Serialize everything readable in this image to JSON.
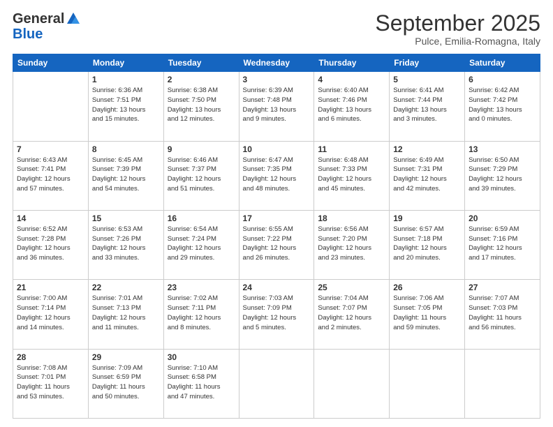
{
  "header": {
    "logo_general": "General",
    "logo_blue": "Blue",
    "month_title": "September 2025",
    "subtitle": "Pulce, Emilia-Romagna, Italy"
  },
  "columns": [
    "Sunday",
    "Monday",
    "Tuesday",
    "Wednesday",
    "Thursday",
    "Friday",
    "Saturday"
  ],
  "weeks": [
    [
      {
        "num": "",
        "info": ""
      },
      {
        "num": "1",
        "info": "Sunrise: 6:36 AM\nSunset: 7:51 PM\nDaylight: 13 hours\nand 15 minutes."
      },
      {
        "num": "2",
        "info": "Sunrise: 6:38 AM\nSunset: 7:50 PM\nDaylight: 13 hours\nand 12 minutes."
      },
      {
        "num": "3",
        "info": "Sunrise: 6:39 AM\nSunset: 7:48 PM\nDaylight: 13 hours\nand 9 minutes."
      },
      {
        "num": "4",
        "info": "Sunrise: 6:40 AM\nSunset: 7:46 PM\nDaylight: 13 hours\nand 6 minutes."
      },
      {
        "num": "5",
        "info": "Sunrise: 6:41 AM\nSunset: 7:44 PM\nDaylight: 13 hours\nand 3 minutes."
      },
      {
        "num": "6",
        "info": "Sunrise: 6:42 AM\nSunset: 7:42 PM\nDaylight: 13 hours\nand 0 minutes."
      }
    ],
    [
      {
        "num": "7",
        "info": "Sunrise: 6:43 AM\nSunset: 7:41 PM\nDaylight: 12 hours\nand 57 minutes."
      },
      {
        "num": "8",
        "info": "Sunrise: 6:45 AM\nSunset: 7:39 PM\nDaylight: 12 hours\nand 54 minutes."
      },
      {
        "num": "9",
        "info": "Sunrise: 6:46 AM\nSunset: 7:37 PM\nDaylight: 12 hours\nand 51 minutes."
      },
      {
        "num": "10",
        "info": "Sunrise: 6:47 AM\nSunset: 7:35 PM\nDaylight: 12 hours\nand 48 minutes."
      },
      {
        "num": "11",
        "info": "Sunrise: 6:48 AM\nSunset: 7:33 PM\nDaylight: 12 hours\nand 45 minutes."
      },
      {
        "num": "12",
        "info": "Sunrise: 6:49 AM\nSunset: 7:31 PM\nDaylight: 12 hours\nand 42 minutes."
      },
      {
        "num": "13",
        "info": "Sunrise: 6:50 AM\nSunset: 7:29 PM\nDaylight: 12 hours\nand 39 minutes."
      }
    ],
    [
      {
        "num": "14",
        "info": "Sunrise: 6:52 AM\nSunset: 7:28 PM\nDaylight: 12 hours\nand 36 minutes."
      },
      {
        "num": "15",
        "info": "Sunrise: 6:53 AM\nSunset: 7:26 PM\nDaylight: 12 hours\nand 33 minutes."
      },
      {
        "num": "16",
        "info": "Sunrise: 6:54 AM\nSunset: 7:24 PM\nDaylight: 12 hours\nand 29 minutes."
      },
      {
        "num": "17",
        "info": "Sunrise: 6:55 AM\nSunset: 7:22 PM\nDaylight: 12 hours\nand 26 minutes."
      },
      {
        "num": "18",
        "info": "Sunrise: 6:56 AM\nSunset: 7:20 PM\nDaylight: 12 hours\nand 23 minutes."
      },
      {
        "num": "19",
        "info": "Sunrise: 6:57 AM\nSunset: 7:18 PM\nDaylight: 12 hours\nand 20 minutes."
      },
      {
        "num": "20",
        "info": "Sunrise: 6:59 AM\nSunset: 7:16 PM\nDaylight: 12 hours\nand 17 minutes."
      }
    ],
    [
      {
        "num": "21",
        "info": "Sunrise: 7:00 AM\nSunset: 7:14 PM\nDaylight: 12 hours\nand 14 minutes."
      },
      {
        "num": "22",
        "info": "Sunrise: 7:01 AM\nSunset: 7:13 PM\nDaylight: 12 hours\nand 11 minutes."
      },
      {
        "num": "23",
        "info": "Sunrise: 7:02 AM\nSunset: 7:11 PM\nDaylight: 12 hours\nand 8 minutes."
      },
      {
        "num": "24",
        "info": "Sunrise: 7:03 AM\nSunset: 7:09 PM\nDaylight: 12 hours\nand 5 minutes."
      },
      {
        "num": "25",
        "info": "Sunrise: 7:04 AM\nSunset: 7:07 PM\nDaylight: 12 hours\nand 2 minutes."
      },
      {
        "num": "26",
        "info": "Sunrise: 7:06 AM\nSunset: 7:05 PM\nDaylight: 11 hours\nand 59 minutes."
      },
      {
        "num": "27",
        "info": "Sunrise: 7:07 AM\nSunset: 7:03 PM\nDaylight: 11 hours\nand 56 minutes."
      }
    ],
    [
      {
        "num": "28",
        "info": "Sunrise: 7:08 AM\nSunset: 7:01 PM\nDaylight: 11 hours\nand 53 minutes."
      },
      {
        "num": "29",
        "info": "Sunrise: 7:09 AM\nSunset: 6:59 PM\nDaylight: 11 hours\nand 50 minutes."
      },
      {
        "num": "30",
        "info": "Sunrise: 7:10 AM\nSunset: 6:58 PM\nDaylight: 11 hours\nand 47 minutes."
      },
      {
        "num": "",
        "info": ""
      },
      {
        "num": "",
        "info": ""
      },
      {
        "num": "",
        "info": ""
      },
      {
        "num": "",
        "info": ""
      }
    ]
  ]
}
